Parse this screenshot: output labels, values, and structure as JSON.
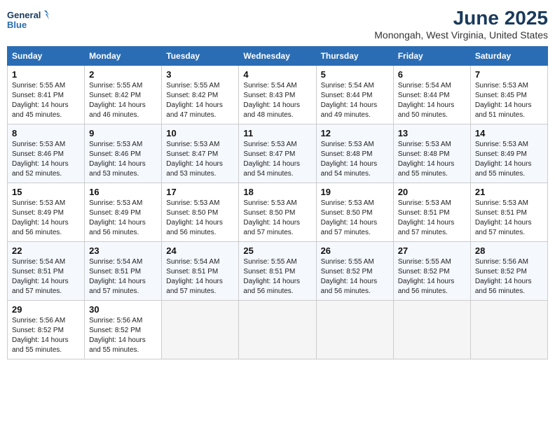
{
  "logo": {
    "line1": "General",
    "line2": "Blue"
  },
  "title": "June 2025",
  "subtitle": "Monongah, West Virginia, United States",
  "weekdays": [
    "Sunday",
    "Monday",
    "Tuesday",
    "Wednesday",
    "Thursday",
    "Friday",
    "Saturday"
  ],
  "weeks": [
    [
      {
        "day": "1",
        "sunrise": "Sunrise: 5:55 AM",
        "sunset": "Sunset: 8:41 PM",
        "daylight": "Daylight: 14 hours and 45 minutes."
      },
      {
        "day": "2",
        "sunrise": "Sunrise: 5:55 AM",
        "sunset": "Sunset: 8:42 PM",
        "daylight": "Daylight: 14 hours and 46 minutes."
      },
      {
        "day": "3",
        "sunrise": "Sunrise: 5:55 AM",
        "sunset": "Sunset: 8:42 PM",
        "daylight": "Daylight: 14 hours and 47 minutes."
      },
      {
        "day": "4",
        "sunrise": "Sunrise: 5:54 AM",
        "sunset": "Sunset: 8:43 PM",
        "daylight": "Daylight: 14 hours and 48 minutes."
      },
      {
        "day": "5",
        "sunrise": "Sunrise: 5:54 AM",
        "sunset": "Sunset: 8:44 PM",
        "daylight": "Daylight: 14 hours and 49 minutes."
      },
      {
        "day": "6",
        "sunrise": "Sunrise: 5:54 AM",
        "sunset": "Sunset: 8:44 PM",
        "daylight": "Daylight: 14 hours and 50 minutes."
      },
      {
        "day": "7",
        "sunrise": "Sunrise: 5:53 AM",
        "sunset": "Sunset: 8:45 PM",
        "daylight": "Daylight: 14 hours and 51 minutes."
      }
    ],
    [
      {
        "day": "8",
        "sunrise": "Sunrise: 5:53 AM",
        "sunset": "Sunset: 8:46 PM",
        "daylight": "Daylight: 14 hours and 52 minutes."
      },
      {
        "day": "9",
        "sunrise": "Sunrise: 5:53 AM",
        "sunset": "Sunset: 8:46 PM",
        "daylight": "Daylight: 14 hours and 53 minutes."
      },
      {
        "day": "10",
        "sunrise": "Sunrise: 5:53 AM",
        "sunset": "Sunset: 8:47 PM",
        "daylight": "Daylight: 14 hours and 53 minutes."
      },
      {
        "day": "11",
        "sunrise": "Sunrise: 5:53 AM",
        "sunset": "Sunset: 8:47 PM",
        "daylight": "Daylight: 14 hours and 54 minutes."
      },
      {
        "day": "12",
        "sunrise": "Sunrise: 5:53 AM",
        "sunset": "Sunset: 8:48 PM",
        "daylight": "Daylight: 14 hours and 54 minutes."
      },
      {
        "day": "13",
        "sunrise": "Sunrise: 5:53 AM",
        "sunset": "Sunset: 8:48 PM",
        "daylight": "Daylight: 14 hours and 55 minutes."
      },
      {
        "day": "14",
        "sunrise": "Sunrise: 5:53 AM",
        "sunset": "Sunset: 8:49 PM",
        "daylight": "Daylight: 14 hours and 55 minutes."
      }
    ],
    [
      {
        "day": "15",
        "sunrise": "Sunrise: 5:53 AM",
        "sunset": "Sunset: 8:49 PM",
        "daylight": "Daylight: 14 hours and 56 minutes."
      },
      {
        "day": "16",
        "sunrise": "Sunrise: 5:53 AM",
        "sunset": "Sunset: 8:49 PM",
        "daylight": "Daylight: 14 hours and 56 minutes."
      },
      {
        "day": "17",
        "sunrise": "Sunrise: 5:53 AM",
        "sunset": "Sunset: 8:50 PM",
        "daylight": "Daylight: 14 hours and 56 minutes."
      },
      {
        "day": "18",
        "sunrise": "Sunrise: 5:53 AM",
        "sunset": "Sunset: 8:50 PM",
        "daylight": "Daylight: 14 hours and 57 minutes."
      },
      {
        "day": "19",
        "sunrise": "Sunrise: 5:53 AM",
        "sunset": "Sunset: 8:50 PM",
        "daylight": "Daylight: 14 hours and 57 minutes."
      },
      {
        "day": "20",
        "sunrise": "Sunrise: 5:53 AM",
        "sunset": "Sunset: 8:51 PM",
        "daylight": "Daylight: 14 hours and 57 minutes."
      },
      {
        "day": "21",
        "sunrise": "Sunrise: 5:53 AM",
        "sunset": "Sunset: 8:51 PM",
        "daylight": "Daylight: 14 hours and 57 minutes."
      }
    ],
    [
      {
        "day": "22",
        "sunrise": "Sunrise: 5:54 AM",
        "sunset": "Sunset: 8:51 PM",
        "daylight": "Daylight: 14 hours and 57 minutes."
      },
      {
        "day": "23",
        "sunrise": "Sunrise: 5:54 AM",
        "sunset": "Sunset: 8:51 PM",
        "daylight": "Daylight: 14 hours and 57 minutes."
      },
      {
        "day": "24",
        "sunrise": "Sunrise: 5:54 AM",
        "sunset": "Sunset: 8:51 PM",
        "daylight": "Daylight: 14 hours and 57 minutes."
      },
      {
        "day": "25",
        "sunrise": "Sunrise: 5:55 AM",
        "sunset": "Sunset: 8:51 PM",
        "daylight": "Daylight: 14 hours and 56 minutes."
      },
      {
        "day": "26",
        "sunrise": "Sunrise: 5:55 AM",
        "sunset": "Sunset: 8:52 PM",
        "daylight": "Daylight: 14 hours and 56 minutes."
      },
      {
        "day": "27",
        "sunrise": "Sunrise: 5:55 AM",
        "sunset": "Sunset: 8:52 PM",
        "daylight": "Daylight: 14 hours and 56 minutes."
      },
      {
        "day": "28",
        "sunrise": "Sunrise: 5:56 AM",
        "sunset": "Sunset: 8:52 PM",
        "daylight": "Daylight: 14 hours and 56 minutes."
      }
    ],
    [
      {
        "day": "29",
        "sunrise": "Sunrise: 5:56 AM",
        "sunset": "Sunset: 8:52 PM",
        "daylight": "Daylight: 14 hours and 55 minutes."
      },
      {
        "day": "30",
        "sunrise": "Sunrise: 5:56 AM",
        "sunset": "Sunset: 8:52 PM",
        "daylight": "Daylight: 14 hours and 55 minutes."
      },
      null,
      null,
      null,
      null,
      null
    ]
  ]
}
